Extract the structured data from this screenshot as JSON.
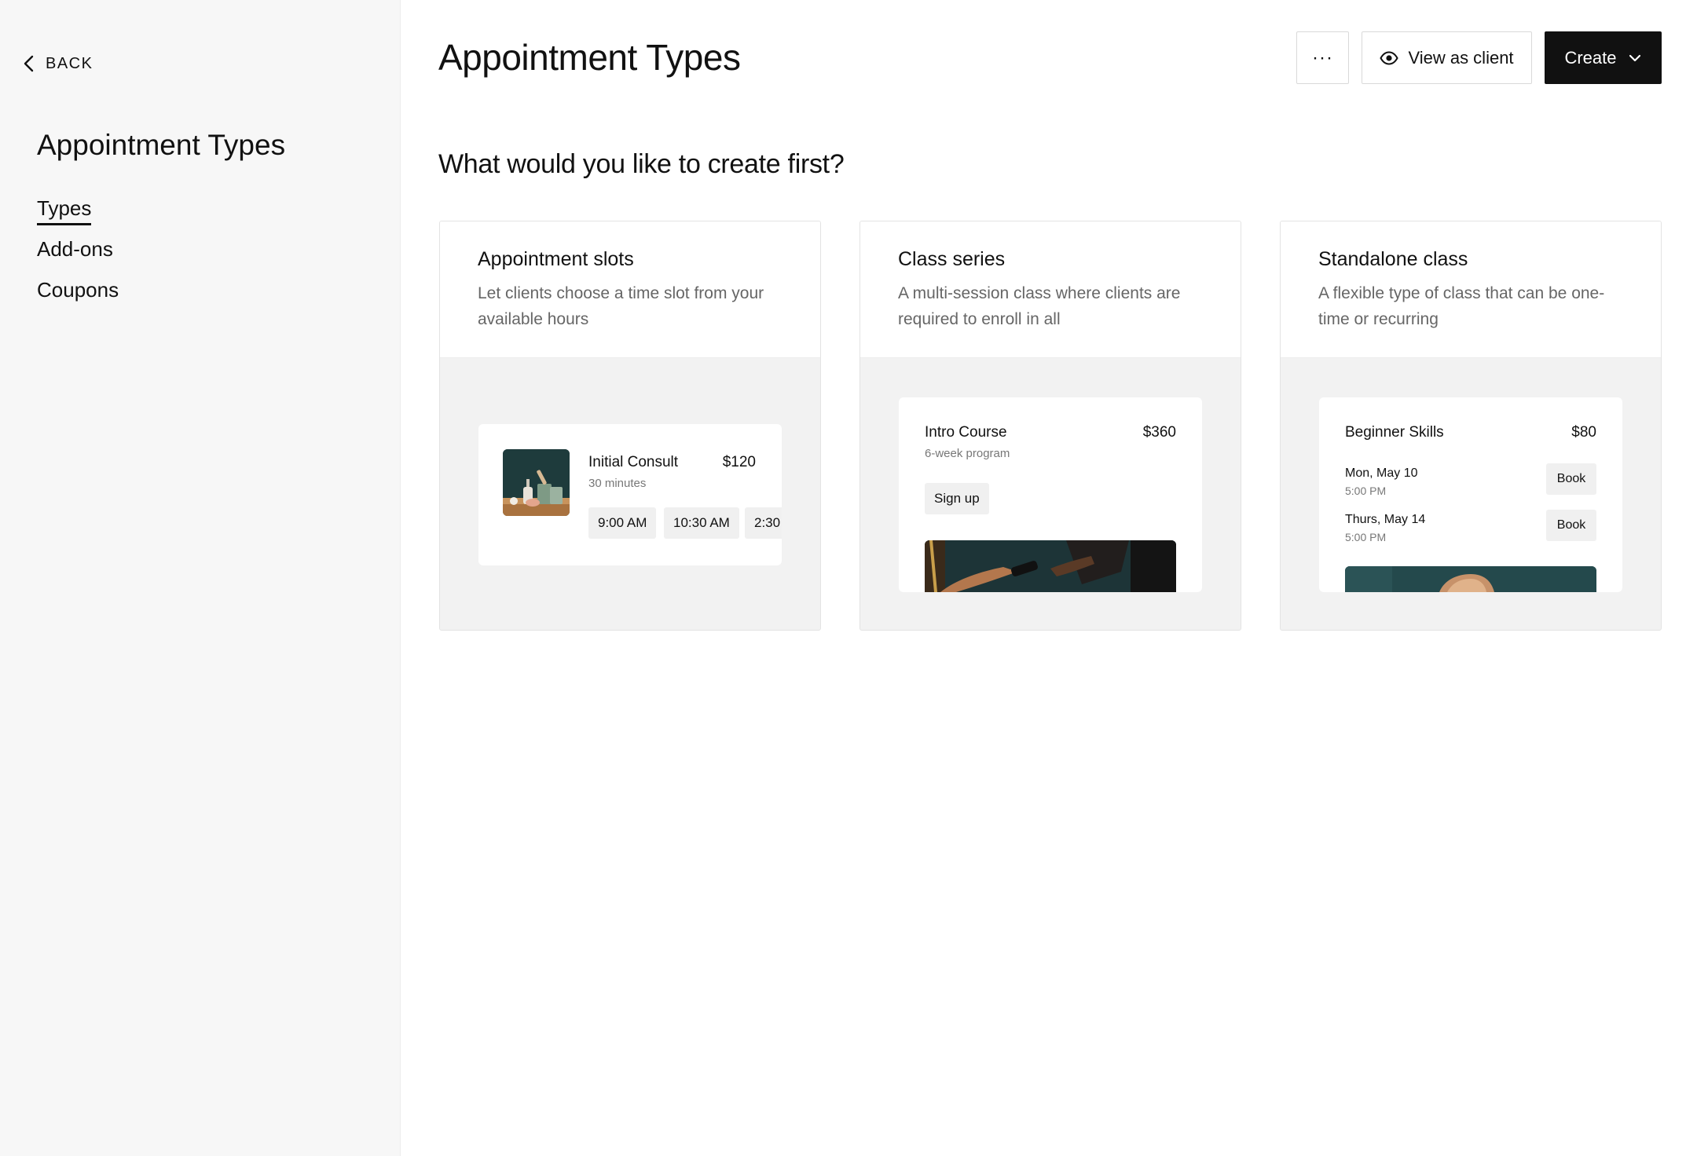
{
  "sidebar": {
    "back_label": "BACK",
    "title": "Appointment Types",
    "nav": [
      {
        "label": "Types",
        "active": true
      },
      {
        "label": "Add-ons",
        "active": false
      },
      {
        "label": "Coupons",
        "active": false
      }
    ]
  },
  "header": {
    "title": "Appointment Types",
    "more_label": "···",
    "view_as_client_label": "View as client",
    "create_label": "Create"
  },
  "main": {
    "question": "What would you like to create first?",
    "cards": [
      {
        "title": "Appointment slots",
        "description": "Let clients choose a time slot from your available hours",
        "preview": {
          "name": "Initial Consult",
          "price": "$120",
          "duration": "30 minutes",
          "slots": [
            "9:00 AM",
            "10:30 AM",
            "2:30"
          ]
        }
      },
      {
        "title": "Class series",
        "description": "A multi-session class where clients are required to enroll in all",
        "preview": {
          "name": "Intro Course",
          "price": "$360",
          "subtitle": "6-week program",
          "button": "Sign up"
        }
      },
      {
        "title": "Standalone class",
        "description": "A flexible type of class that can be one-time or recurring",
        "preview": {
          "name": "Beginner Skills",
          "price": "$80",
          "sessions": [
            {
              "date": "Mon, May 10",
              "time": "5:00 PM",
              "button": "Book"
            },
            {
              "date": "Thurs, May 14",
              "time": "5:00 PM",
              "button": "Book"
            }
          ]
        }
      }
    ]
  },
  "colors": {
    "primary_button": "#111111",
    "sidebar_bg": "#f7f7f7",
    "card_preview_bg": "#f2f2f2",
    "text_muted": "#666666"
  },
  "icons": {
    "back": "chevron-left-icon",
    "view": "eye-icon",
    "create": "chevron-down-icon"
  }
}
